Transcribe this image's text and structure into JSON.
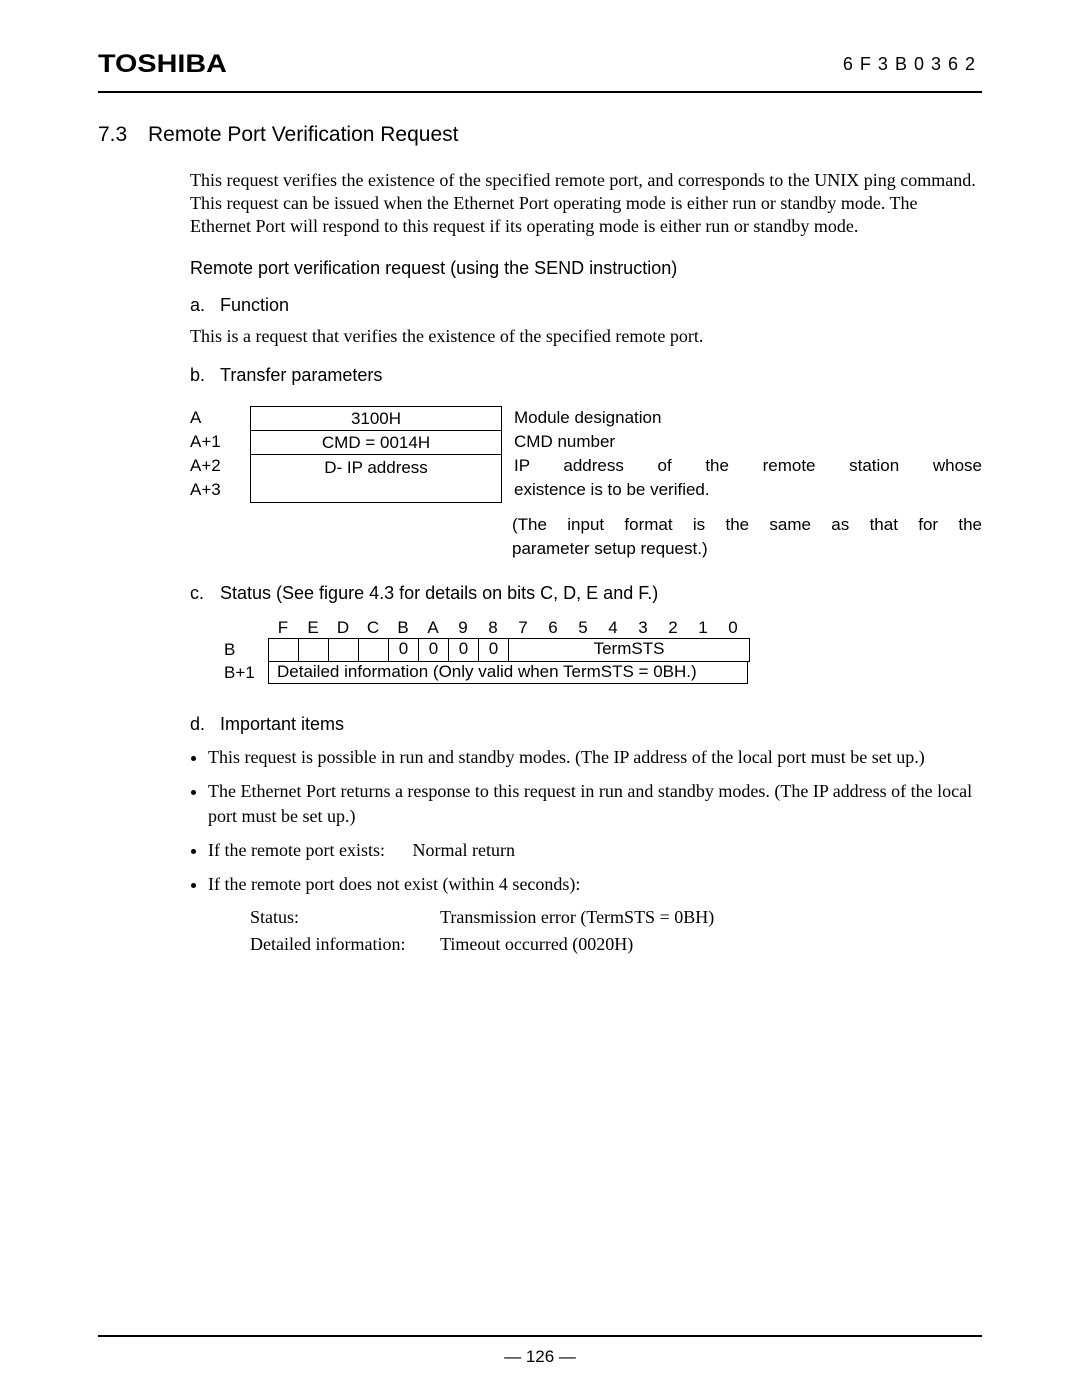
{
  "header": {
    "brand": "TOSHIBA",
    "docnum": "6F3B0362"
  },
  "section": {
    "number": "7.3",
    "title": "Remote Port Verification Request"
  },
  "intro_para": "This request verifies the existence of the specified remote port, and corresponds to the UNIX ping command. This request can be issued when the Ethernet Port operating mode is either run or standby mode. The Ethernet Port will respond to this request if its operating mode is either run or standby mode.",
  "subhead": "Remote port verification request (using the SEND instruction)",
  "item_a": {
    "label": "a.",
    "title": "Function"
  },
  "item_a_text": "This is a request that verifies the existence of the specified remote port.",
  "item_b": {
    "label": "b.",
    "title": "Transfer parameters"
  },
  "tparams": {
    "row_labels": [
      "A",
      "A+1",
      "A+2",
      "A+3"
    ],
    "cells": [
      "3100H",
      "CMD = 0014H",
      "D- IP address"
    ],
    "descs": {
      "module": "Module designation",
      "cmd": "CMD number",
      "ip1": "IP address of the remote station whose",
      "ip2": "existence is to be verified.",
      "note1": "(The input format is the same as that for the",
      "note2": "parameter setup request.)"
    }
  },
  "item_c": {
    "label": "c.",
    "title": "Status (See figure 4.3 for details on bits C, D, E and F.)"
  },
  "status_table": {
    "bits": [
      "F",
      "E",
      "D",
      "C",
      "B",
      "A",
      "9",
      "8",
      "7",
      "6",
      "5",
      "4",
      "3",
      "2",
      "1",
      "0"
    ],
    "row_labels": [
      "B",
      "B+1"
    ],
    "zeros": [
      "0",
      "0",
      "0",
      "0"
    ],
    "termsts": "TermSTS",
    "row2": "Detailed information (Only valid when TermSTS = 0BH.)"
  },
  "item_d": {
    "label": "d.",
    "title": "Important items"
  },
  "bullets": [
    "This request is possible in run and standby modes. (The IP address of the local port must be set up.)",
    "The Ethernet Port returns a response to this request in run and standby modes. (The IP address of the local port must be set up.)"
  ],
  "bullet3": {
    "prefix": "If the remote port exists:",
    "value": "Normal return"
  },
  "bullet4": "If the remote port does not exist (within 4 seconds):",
  "kv": {
    "status_k": "Status:",
    "status_v": "Transmission error (TermSTS = 0BH)",
    "detail_k": "Detailed information:",
    "detail_v": "Timeout occurred (0020H)"
  },
  "pagenum": "— 126 —"
}
